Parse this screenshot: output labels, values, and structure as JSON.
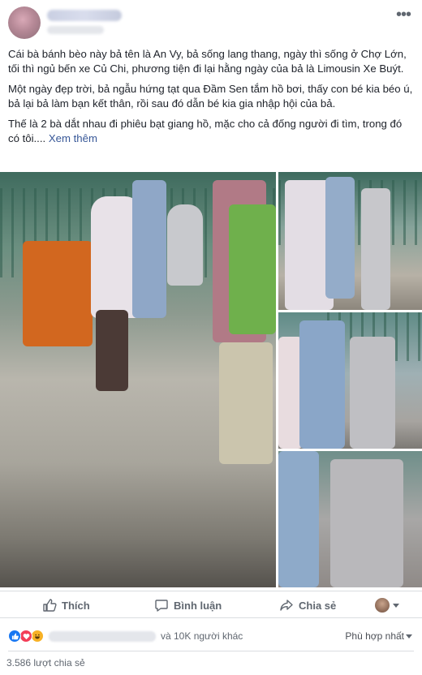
{
  "post": {
    "paragraphs": [
      "Cái bà bánh bèo này bả tên là An Vy, bả sống lang thang, ngày thì sống ở Chợ Lớn, tối thì ngủ bến xe Củ Chi, phương tiện đi lại hằng ngày của bả là Limousin Xe Buýt.",
      "Một ngày đẹp trời, bả ngẫu hứng tạt qua Đầm Sen tắm hồ bơi, thấy con bé kia béo ú, bả lại bả làm bạn kết thân, rồi sau đó dẫn bé kia gia nhập hội của bả."
    ],
    "last_paragraph": "Thế là 2 bà dắt nhau đi phiêu bạt giang hồ, mặc cho cả đống người đi tìm, trong đó có tôi....",
    "see_more": "Xem thêm"
  },
  "actions": {
    "like": "Thích",
    "comment": "Bình luận",
    "share": "Chia sẻ"
  },
  "stats": {
    "others_text": "và 10K người khác",
    "sort_label": "Phù hợp nhất",
    "shares_text": "3.586 lượt chia sẻ"
  },
  "icons": {
    "more": "more-options-icon",
    "like": "thumbs-up-icon",
    "comment": "comment-bubble-icon",
    "share": "share-arrow-icon",
    "reaction_like": "like-reaction-icon",
    "reaction_love": "love-reaction-icon",
    "reaction_haha": "haha-reaction-icon"
  },
  "colors": {
    "link": "#385898",
    "secondary_text": "#606770",
    "like_blue": "#1877f2",
    "love_red": "#f33e58",
    "haha_yellow": "#f7b125"
  }
}
